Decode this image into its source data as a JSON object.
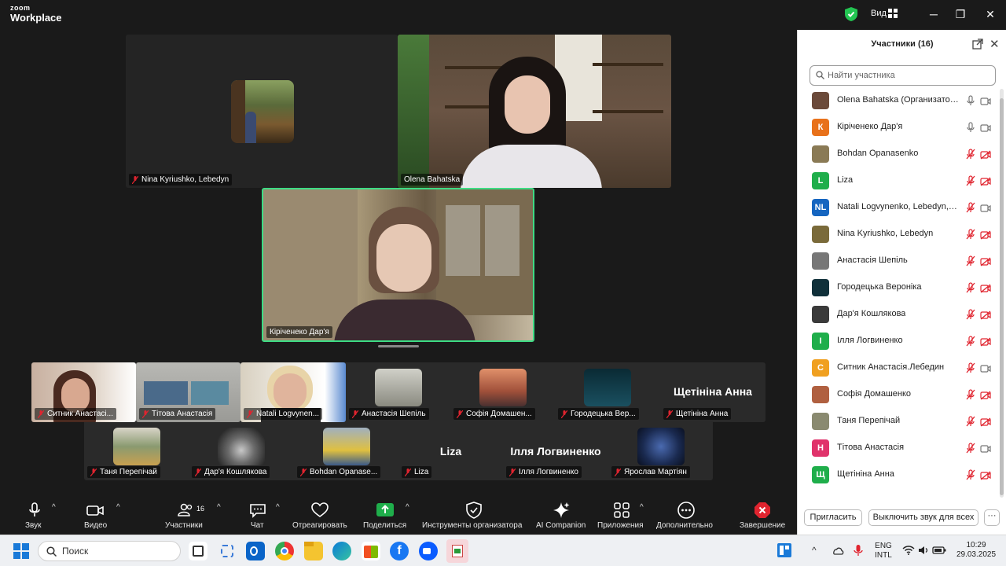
{
  "app": {
    "logo_top": "zoom",
    "logo_bottom": "Workplace",
    "view_label": "Вид"
  },
  "window": {
    "minimize": "─",
    "maximize": "❐",
    "close": "✕"
  },
  "stage": {
    "main_tiles": [
      {
        "name": "Nina Kyriushko, Lebedyn"
      },
      {
        "name": "Olena Bahatska"
      },
      {
        "name": "Кіріченеко Дар'я"
      }
    ],
    "strip_row1": [
      {
        "name": "Ситник Анастасі..."
      },
      {
        "name": "Тітова Анастасія"
      },
      {
        "name": "Natali Logvynen..."
      },
      {
        "name": "Анастасія Шепіль"
      },
      {
        "name": "Софія Домашен..."
      },
      {
        "name": "Городецька Вер..."
      },
      {
        "name": "Щетініна Анна",
        "big": "Щетініна Анна"
      }
    ],
    "strip_row2": [
      {
        "name": "Таня Перепічай"
      },
      {
        "name": "Дар'я Кошлякова"
      },
      {
        "name": "Bohdan Opanase..."
      },
      {
        "name": "Liza",
        "big": "Liza"
      },
      {
        "name": "Ілля Логвиненко",
        "big": "Ілля Логвиненко"
      },
      {
        "name": "Ярослав Мартіян"
      }
    ]
  },
  "panel": {
    "title": "Участники (16)",
    "search_placeholder": "Найти участника",
    "participants": [
      {
        "name": "Olena Bahatska (Организатор, я)",
        "initials": "",
        "color": "#6b4a3a",
        "mic": "on",
        "cam": "on"
      },
      {
        "name": "Кіріченеко Дар'я",
        "initials": "К",
        "color": "#e8711a",
        "mic": "on",
        "cam": "on"
      },
      {
        "name": "Bohdan Opanasenko",
        "initials": "",
        "color": "#8a7a55",
        "mic": "off",
        "cam": "off"
      },
      {
        "name": "Liza",
        "initials": "L",
        "color": "#1fae4b",
        "mic": "off",
        "cam": "off"
      },
      {
        "name": "Natali Logvynenko, Lebedyn, Su...",
        "initials": "NL",
        "color": "#1565c0",
        "mic": "off",
        "cam": "on"
      },
      {
        "name": "Nina Kyriushko, Lebedyn",
        "initials": "",
        "color": "#7a6a3a",
        "mic": "off",
        "cam": "off"
      },
      {
        "name": "Анастасія Шепіль",
        "initials": "",
        "color": "#777777",
        "mic": "off",
        "cam": "off"
      },
      {
        "name": "Городецька Вероніка",
        "initials": "",
        "color": "#10303a",
        "mic": "off",
        "cam": "off"
      },
      {
        "name": "Дар'я Кошлякова",
        "initials": "",
        "color": "#3a3a3a",
        "mic": "off",
        "cam": "off"
      },
      {
        "name": "Ілля Логвиненко",
        "initials": "І",
        "color": "#1fae4b",
        "mic": "off",
        "cam": "off"
      },
      {
        "name": "Ситник Анастасія.Лебедин",
        "initials": "С",
        "color": "#f0a020",
        "mic": "off",
        "cam": "on"
      },
      {
        "name": "Софія Домашенко",
        "initials": "",
        "color": "#b06040",
        "mic": "off",
        "cam": "off"
      },
      {
        "name": "Таня Перепічай",
        "initials": "",
        "color": "#8a8a70",
        "mic": "off",
        "cam": "off"
      },
      {
        "name": "Тітова Анастасія",
        "initials": "Н",
        "color": "#e0336b",
        "mic": "off",
        "cam": "on"
      },
      {
        "name": "Щетініна Анна",
        "initials": "Щ",
        "color": "#1fae4b",
        "mic": "off",
        "cam": "off"
      }
    ],
    "invite_label": "Пригласить",
    "mute_all_label": "Выключить звук для всех",
    "more_label": "···"
  },
  "toolbar": {
    "audio": "Звук",
    "video": "Видео",
    "participants": "Участники",
    "participants_count": "16",
    "chat": "Чат",
    "react": "Отреагировать",
    "share": "Поделиться",
    "host_tools": "Инструменты организатора",
    "ai": "AI Companion",
    "apps": "Приложения",
    "more": "Дополнительно",
    "end": "Завершение"
  },
  "taskbar": {
    "search": "Поиск",
    "lang_top": "ENG",
    "lang_bottom": "INTL",
    "time": "10:29",
    "date": "29.03.2025"
  },
  "colors": {
    "accent": "#0b5cff",
    "active_speaker": "#3ddc84",
    "muted": "#e0242f",
    "share_green": "#1fae4b"
  }
}
